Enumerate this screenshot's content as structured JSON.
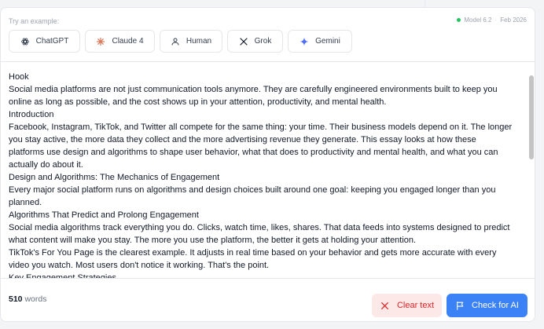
{
  "header": {
    "try_label": "Try an example:",
    "model_name": "Model 6.2",
    "separator": "·",
    "model_date": "Feb 2026",
    "status_color": "#22c55e"
  },
  "examples": [
    {
      "label": "ChatGPT",
      "icon": "openai-icon"
    },
    {
      "label": "Claude 4",
      "icon": "claude-icon",
      "color": "#d97757"
    },
    {
      "label": "Human",
      "icon": "person-icon"
    },
    {
      "label": "Grok",
      "icon": "x-logo-icon"
    },
    {
      "label": "Gemini",
      "icon": "gemini-sparkle-icon",
      "color": "#4f6ef7"
    }
  ],
  "editor": {
    "lines": [
      "Hook",
      "Social media platforms are not just communication tools anymore. They are carefully engineered environments built to keep you online as long as possible, and the cost shows up in your attention, productivity, and mental health.",
      "Introduction",
      "Facebook, Instagram, TikTok, and Twitter all compete for the same thing: your time. Their business models depend on it. The longer you stay active, the more data they collect and the more advertising revenue they generate. This essay looks at how these platforms use design and algorithms to shape user behavior, what that does to productivity and mental health, and what you can actually do about it.",
      "Design and Algorithms: The Mechanics of Engagement",
      "Every major social platform runs on algorithms and design choices built around one goal: keeping you engaged longer than you planned.",
      "Algorithms That Predict and Prolong Engagement",
      "Social media algorithms track everything you do. Clicks, watch time, likes, shares. That data feeds into systems designed to predict what content will make you stay. The more you use the platform, the better it gets at holding your attention.",
      "TikTok's For You Page is the clearest example. It adjusts in real time based on your behavior and gets more accurate with every video you watch. Most users don't notice it working. That's the point.",
      "Key Engagement Strategies"
    ]
  },
  "footer": {
    "word_count": "510",
    "word_label": "words",
    "clear_label": "Clear text",
    "check_label": "Check for AI",
    "clear_color": "#dc2626",
    "check_color": "#3b82f6"
  }
}
